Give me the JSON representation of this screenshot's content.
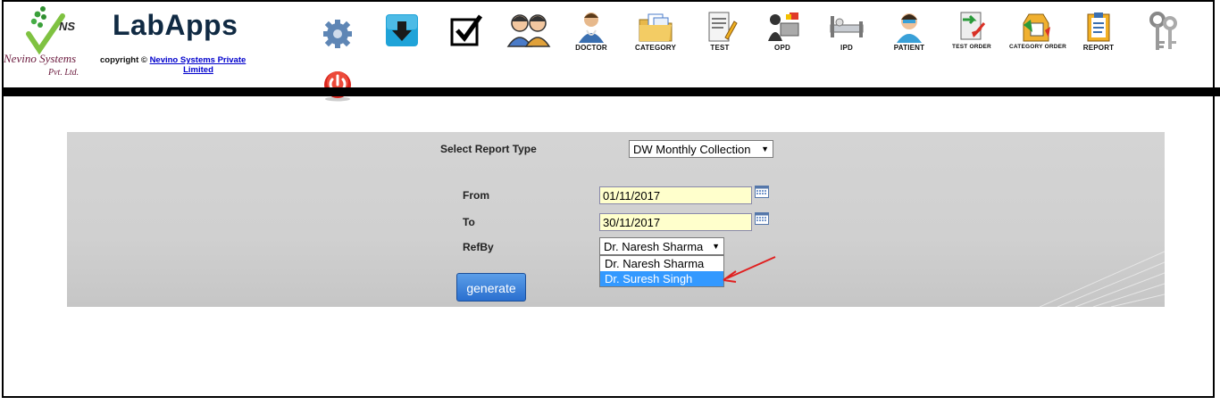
{
  "header": {
    "logo": {
      "top_text": "NS",
      "main_text": "Nevino Systems",
      "sub_text": "Pvt. Ltd."
    },
    "app_title": "LabApps",
    "copyright_prefix": "copyright ©",
    "copyright_link_line1": "Nevino Systems Private",
    "copyright_link_line2": "Limited"
  },
  "toolbar": [
    {
      "icon": "gear-icon",
      "label": ""
    },
    {
      "icon": "download-icon",
      "label": ""
    },
    {
      "icon": "checkbox-icon",
      "label": ""
    },
    {
      "icon": "users-icon",
      "label": ""
    },
    {
      "icon": "doctor-icon",
      "label": "DOCTOR"
    },
    {
      "icon": "folder-icon",
      "label": "CATEGORY"
    },
    {
      "icon": "document-pencil-icon",
      "label": "TEST"
    },
    {
      "icon": "opd-icon",
      "label": "OPD"
    },
    {
      "icon": "bed-icon",
      "label": "IPD"
    },
    {
      "icon": "patient-icon",
      "label": "PATIENT"
    },
    {
      "icon": "test-order-icon",
      "label": "TEST ORDER"
    },
    {
      "icon": "category-order-icon",
      "label": "CATEGORY ORDER"
    },
    {
      "icon": "report-icon",
      "label": "REPORT"
    },
    {
      "icon": "keys-icon",
      "label": ""
    }
  ],
  "form": {
    "report_type_label": "Select Report Type",
    "report_type_value": "DW Monthly Collection",
    "from_label": "From",
    "from_value": "01/11/2017",
    "to_label": "To",
    "to_value": "30/11/2017",
    "refby_label": "RefBy",
    "refby_value": "Dr. Naresh Sharma",
    "refby_options": [
      "Dr. Naresh Sharma",
      "Dr. Suresh Singh"
    ],
    "generate_label": "generate"
  },
  "colors": {
    "accent_blue": "#3399ff",
    "input_bg": "#ffffcc",
    "button_blue": "#2a6fcf",
    "power_red": "#d9241c",
    "annotation_red": "#e02020"
  }
}
